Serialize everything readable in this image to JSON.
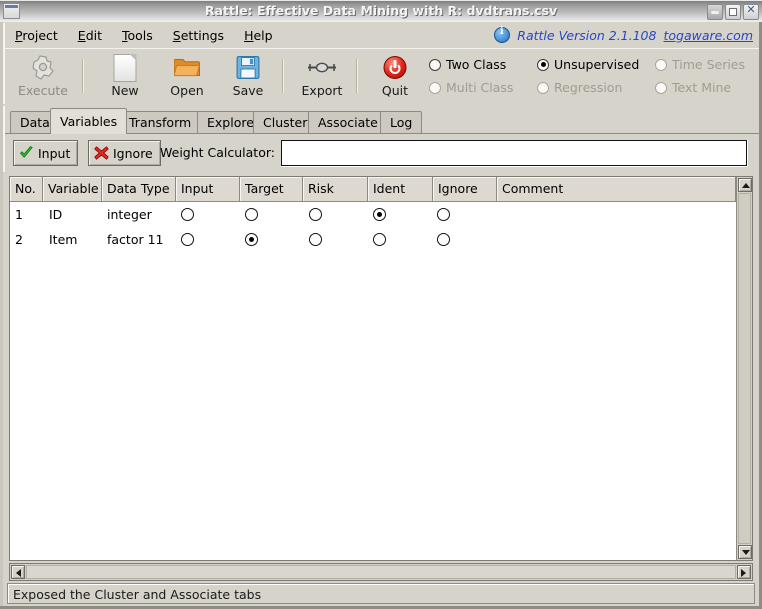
{
  "window": {
    "title": "Rattle: Effective Data Mining with R: dvdtrans.csv",
    "buttons": {
      "minimize": "minimize-button",
      "maximize": "maximize-button",
      "close": "close-button"
    }
  },
  "menubar": {
    "items": [
      {
        "label": "Project",
        "mnemonic": "P"
      },
      {
        "label": "Edit",
        "mnemonic": "E"
      },
      {
        "label": "Tools",
        "mnemonic": "T"
      },
      {
        "label": "Settings",
        "mnemonic": "S"
      },
      {
        "label": "Help",
        "mnemonic": "H"
      }
    ],
    "brand": "Rattle  Version  2.1.108",
    "link": "togaware.com",
    "link_color": "#2846c8"
  },
  "toolbar": {
    "tools": [
      {
        "label": "Execute",
        "icon": "gear-icon",
        "enabled": false
      },
      {
        "label": "New",
        "icon": "new-document-icon",
        "enabled": true
      },
      {
        "label": "Open",
        "icon": "folder-open-icon",
        "enabled": true
      },
      {
        "label": "Save",
        "icon": "floppy-save-icon",
        "enabled": true
      },
      {
        "label": "Export",
        "icon": "export-icon",
        "enabled": true
      },
      {
        "label": "Quit",
        "icon": "power-quit-icon",
        "enabled": true
      }
    ],
    "modes": [
      {
        "label": "Two Class",
        "selected": false,
        "enabled": true
      },
      {
        "label": "Unsupervised",
        "selected": true,
        "enabled": true
      },
      {
        "label": "Time Series",
        "selected": false,
        "enabled": false
      },
      {
        "label": "Multi Class",
        "selected": false,
        "enabled": false
      },
      {
        "label": "Regression",
        "selected": false,
        "enabled": false
      },
      {
        "label": "Text Mine",
        "selected": false,
        "enabled": false
      }
    ]
  },
  "tabs": [
    {
      "label": "Data",
      "active": false
    },
    {
      "label": "Variables",
      "active": true
    },
    {
      "label": "Transform",
      "active": false
    },
    {
      "label": "Explore",
      "active": false
    },
    {
      "label": "Cluster",
      "active": false
    },
    {
      "label": "Associate",
      "active": false
    },
    {
      "label": "Log",
      "active": false
    }
  ],
  "actions": {
    "input_button": "Input",
    "ignore_button": "Ignore",
    "weight_label": "Weight Calculator:",
    "weight_value": "",
    "weight_placeholder": ""
  },
  "table": {
    "columns": [
      "No.",
      "Variable",
      "Data Type",
      "Input",
      "Target",
      "Risk",
      "Ident",
      "Ignore",
      "Comment"
    ],
    "rows": [
      {
        "no": "1",
        "variable": "ID",
        "data_type": "integer",
        "role": "Ident",
        "comment": ""
      },
      {
        "no": "2",
        "variable": "Item",
        "data_type": "factor 11",
        "role": "Target",
        "comment": ""
      }
    ],
    "role_columns": [
      "Input",
      "Target",
      "Risk",
      "Ident",
      "Ignore"
    ]
  },
  "statusbar": {
    "message": "Exposed the Cluster and Associate tabs"
  }
}
